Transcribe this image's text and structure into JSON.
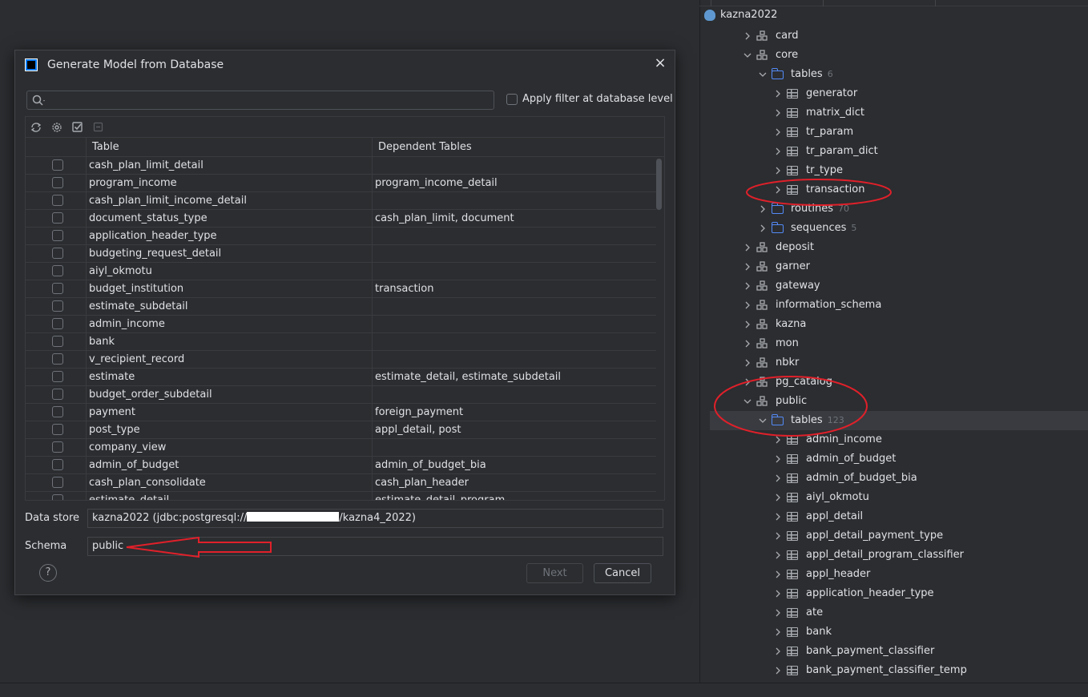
{
  "dialog": {
    "title": "Generate Model from Database",
    "search_placeholder": "",
    "filter_label": "Apply filter at database level",
    "columns": [
      "Table",
      "Dependent Tables"
    ],
    "rows": [
      {
        "table": "cash_plan_limit_detail",
        "deps": ""
      },
      {
        "table": "program_income",
        "deps": "program_income_detail"
      },
      {
        "table": "cash_plan_limit_income_detail",
        "deps": ""
      },
      {
        "table": "document_status_type",
        "deps": "cash_plan_limit, document"
      },
      {
        "table": "application_header_type",
        "deps": ""
      },
      {
        "table": "budgeting_request_detail",
        "deps": ""
      },
      {
        "table": "aiyl_okmotu",
        "deps": ""
      },
      {
        "table": "budget_institution",
        "deps": "transaction"
      },
      {
        "table": "estimate_subdetail",
        "deps": ""
      },
      {
        "table": "admin_income",
        "deps": ""
      },
      {
        "table": "bank",
        "deps": ""
      },
      {
        "table": "v_recipient_record",
        "deps": ""
      },
      {
        "table": "estimate",
        "deps": "estimate_detail, estimate_subdetail"
      },
      {
        "table": "budget_order_subdetail",
        "deps": ""
      },
      {
        "table": "payment",
        "deps": "foreign_payment"
      },
      {
        "table": "post_type",
        "deps": "appl_detail, post"
      },
      {
        "table": "company_view",
        "deps": ""
      },
      {
        "table": "admin_of_budget",
        "deps": "admin_of_budget_bia"
      },
      {
        "table": "cash_plan_consolidate",
        "deps": "cash_plan_header"
      },
      {
        "table": "estimate_detail",
        "deps": "estimate_detail_program"
      }
    ],
    "data_store_label": "Data store",
    "data_store_prefix": "kazna2022 (jdbc:postgresql://",
    "data_store_suffix": "/kazna4_2022)",
    "schema_label": "Schema",
    "schema_value": "public",
    "help_label": "?",
    "next_label": "Next",
    "cancel_label": "Cancel",
    "close_label": "×"
  },
  "tree": {
    "root": "kazna2022",
    "items": [
      {
        "label": "card",
        "count": ""
      },
      {
        "label": "core",
        "count": ""
      },
      {
        "label": "tables",
        "count": "6"
      },
      {
        "label": "generator",
        "count": ""
      },
      {
        "label": "matrix_dict",
        "count": ""
      },
      {
        "label": "tr_param",
        "count": ""
      },
      {
        "label": "tr_param_dict",
        "count": ""
      },
      {
        "label": "tr_type",
        "count": ""
      },
      {
        "label": "transaction",
        "count": ""
      },
      {
        "label": "routines",
        "count": "70"
      },
      {
        "label": "sequences",
        "count": "5"
      },
      {
        "label": "deposit",
        "count": ""
      },
      {
        "label": "garner",
        "count": ""
      },
      {
        "label": "gateway",
        "count": ""
      },
      {
        "label": "information_schema",
        "count": ""
      },
      {
        "label": "kazna",
        "count": ""
      },
      {
        "label": "mon",
        "count": ""
      },
      {
        "label": "nbkr",
        "count": ""
      },
      {
        "label": "pg_catalog",
        "count": ""
      },
      {
        "label": "public",
        "count": ""
      },
      {
        "label": "tables",
        "count": "123"
      },
      {
        "label": "admin_income",
        "count": ""
      },
      {
        "label": "admin_of_budget",
        "count": ""
      },
      {
        "label": "admin_of_budget_bia",
        "count": ""
      },
      {
        "label": "aiyl_okmotu",
        "count": ""
      },
      {
        "label": "appl_detail",
        "count": ""
      },
      {
        "label": "appl_detail_payment_type",
        "count": ""
      },
      {
        "label": "appl_detail_program_classifier",
        "count": ""
      },
      {
        "label": "appl_header",
        "count": ""
      },
      {
        "label": "application_header_type",
        "count": ""
      },
      {
        "label": "ate",
        "count": ""
      },
      {
        "label": "bank",
        "count": ""
      },
      {
        "label": "bank_payment_classifier",
        "count": ""
      },
      {
        "label": "bank_payment_classifier_temp",
        "count": ""
      }
    ]
  },
  "colors": {
    "background": "#2b2d30",
    "annotation": "#e0202a",
    "folder": "#548af7"
  }
}
